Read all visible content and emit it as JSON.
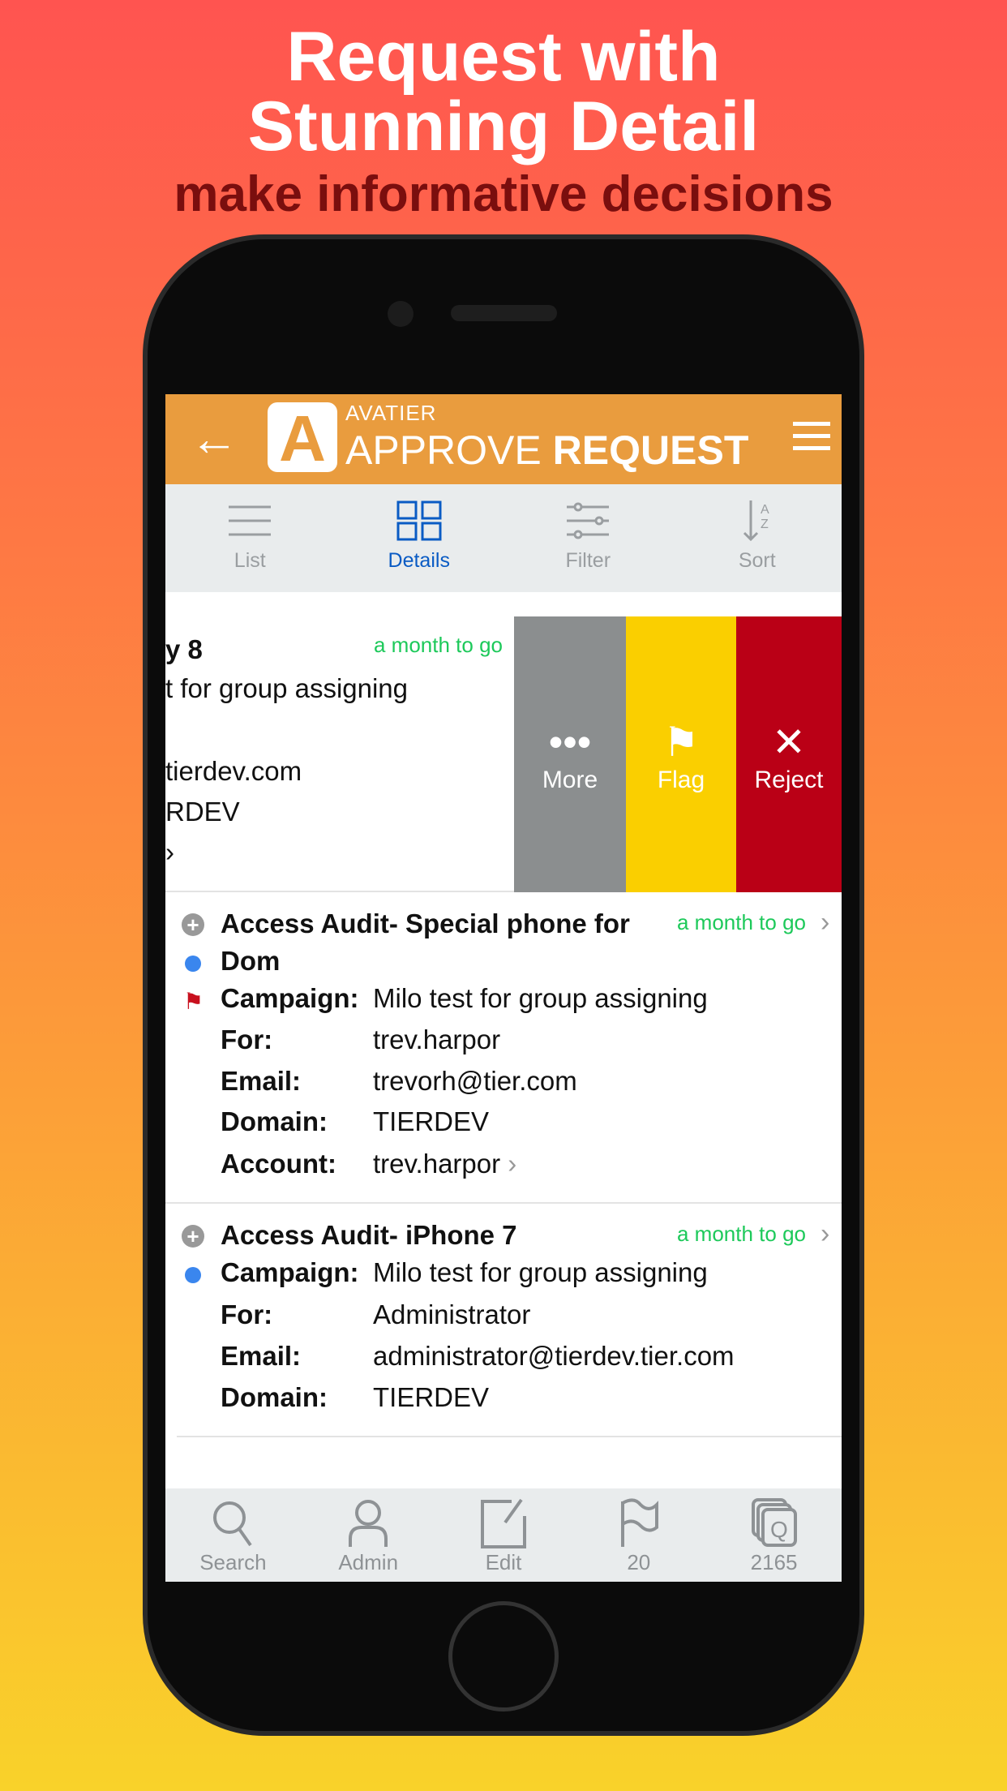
{
  "headline": {
    "line1": "Request with",
    "line2": "Stunning Detail",
    "line3": "make informative decisions"
  },
  "header": {
    "brand": "AVATIER",
    "title_light": "APPROVE",
    "title_bold": "REQUEST",
    "color": "#E99C3E"
  },
  "toolbar": [
    {
      "label": "List",
      "icon": "list-icon"
    },
    {
      "label": "Details",
      "icon": "grid-icon",
      "active": true
    },
    {
      "label": "Filter",
      "icon": "sliders-icon"
    },
    {
      "label": "Sort",
      "icon": "sort-az-icon"
    }
  ],
  "swiped_row": {
    "title_fragment": "y 8",
    "campaign_fragment": "t for group assigning",
    "email_fragment": "tierdev.com",
    "domain_fragment": "RDEV",
    "account_fragment": "›",
    "due": "a month to go",
    "actions": [
      {
        "label": "More",
        "color": "#8B8E8F"
      },
      {
        "label": "Flag",
        "color": "#FACF00"
      },
      {
        "label": "Reject",
        "color": "#BA0016"
      }
    ]
  },
  "requests": [
    {
      "title_l1": "Access Audit- Special phone for",
      "title_l2": "Dom",
      "due": "a month to go",
      "flagged": true,
      "fields": [
        {
          "label": "Campaign:",
          "value": "Milo test for group assigning"
        },
        {
          "label": "For:",
          "value": "trev.harpor"
        },
        {
          "label": "Email:",
          "value": "trevorh@tier.com"
        },
        {
          "label": "Domain:",
          "value": "TIERDEV"
        },
        {
          "label": "Account:",
          "value": "trev.harpor"
        }
      ]
    },
    {
      "title_l1": "Access Audit- iPhone 7",
      "due": "a month to go",
      "fields": [
        {
          "label": "Campaign:",
          "value": "Milo test for group assigning"
        },
        {
          "label": "For:",
          "value": "Administrator"
        },
        {
          "label": "Email:",
          "value": "administrator@tierdev.tier.com"
        },
        {
          "label": "Domain:",
          "value": "TIERDEV"
        }
      ]
    }
  ],
  "bottom_bar": [
    {
      "label": "Search",
      "icon": "search-icon"
    },
    {
      "label": "Admin",
      "icon": "user-icon"
    },
    {
      "label": "Edit",
      "icon": "edit-icon"
    },
    {
      "label": "20",
      "icon": "flag-icon"
    },
    {
      "label": "2165",
      "icon": "queue-icon"
    }
  ]
}
